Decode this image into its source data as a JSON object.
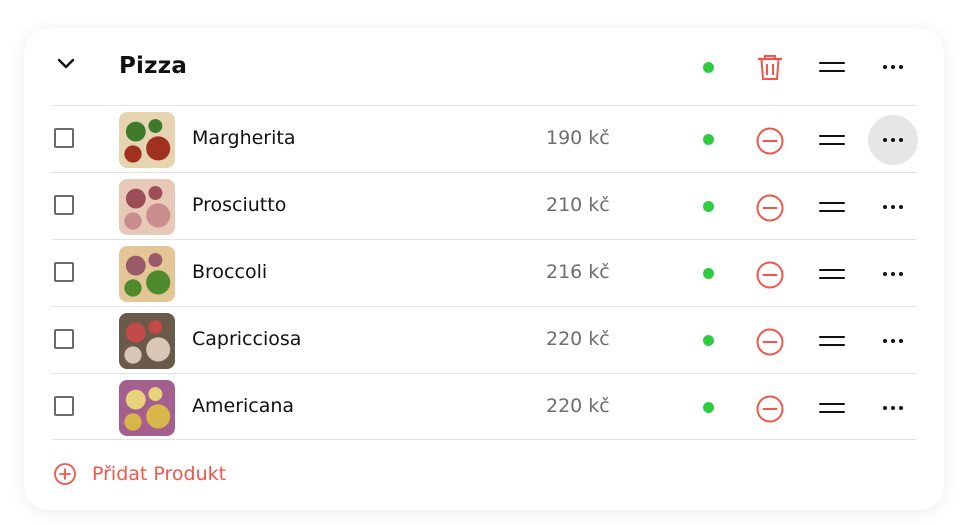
{
  "category": {
    "title": "Pizza",
    "status_color": "#2ecc40",
    "icons": {
      "collapse": "chevron-down-icon",
      "delete": "trash-icon",
      "reorder": "drag-handle-icon",
      "more": "more-horizontal-icon"
    }
  },
  "products": [
    {
      "name": "Margherita",
      "price": "190 kč",
      "thumb_colors": [
        "#a2301f",
        "#e6d3b0",
        "#3f7a2a"
      ],
      "menu_active": true
    },
    {
      "name": "Prosciutto",
      "price": "210 kč",
      "thumb_colors": [
        "#c98d8d",
        "#e8c9b8",
        "#9c4d57"
      ],
      "menu_active": false
    },
    {
      "name": "Broccoli",
      "price": "216 kč",
      "thumb_colors": [
        "#4f8a2c",
        "#e3c596",
        "#9a5a6a"
      ],
      "menu_active": false
    },
    {
      "name": "Capricciosa",
      "price": "220 kč",
      "thumb_colors": [
        "#d8c7b4",
        "#6b5a4a",
        "#c24a48"
      ],
      "menu_active": false
    },
    {
      "name": "Americana",
      "price": "220 kč",
      "thumb_colors": [
        "#d9b64a",
        "#a45f8e",
        "#e8d27a"
      ],
      "menu_active": false
    }
  ],
  "add_product": {
    "label": "Přidat Produkt",
    "icon": "plus-circle-icon"
  },
  "colors": {
    "accent_red": "#f0564a",
    "status_green": "#2ecc40",
    "active_menu_bg": "#e6e6e6"
  }
}
